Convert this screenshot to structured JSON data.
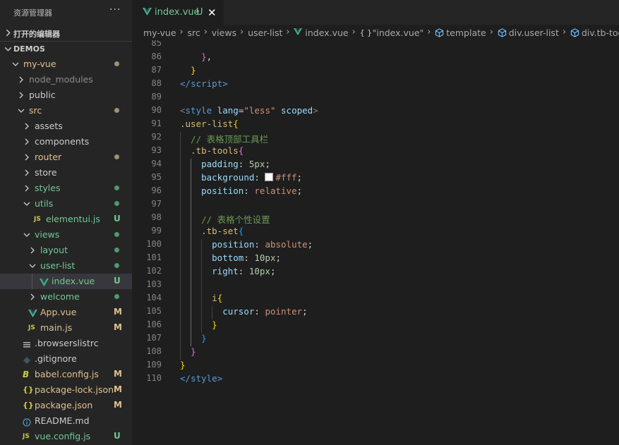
{
  "explorer": {
    "title": "资源管理器",
    "more": "···",
    "open_editors": "打开的编辑器",
    "root": "DEMOS"
  },
  "tree": [
    {
      "name": "my-vue",
      "indent": 0,
      "kind": "folder",
      "open": true,
      "color": "#e2c08d",
      "status": "dot",
      "status_color": "#a08f72"
    },
    {
      "name": "node_modules",
      "indent": 1,
      "kind": "folder",
      "open": false,
      "color": "#8c8c8c"
    },
    {
      "name": "public",
      "indent": 1,
      "kind": "folder",
      "open": false,
      "color": "#cccccc"
    },
    {
      "name": "src",
      "indent": 1,
      "kind": "folder",
      "open": true,
      "color": "#e2c08d",
      "status": "dot",
      "status_color": "#a08f72"
    },
    {
      "name": "assets",
      "indent": 2,
      "kind": "folder",
      "open": false,
      "color": "#cccccc"
    },
    {
      "name": "components",
      "indent": 2,
      "kind": "folder",
      "open": false,
      "color": "#cccccc"
    },
    {
      "name": "router",
      "indent": 2,
      "kind": "folder",
      "open": false,
      "color": "#e2c08d",
      "status": "dot",
      "status_color": "#a08f72"
    },
    {
      "name": "store",
      "indent": 2,
      "kind": "folder",
      "open": false,
      "color": "#cccccc"
    },
    {
      "name": "styles",
      "indent": 2,
      "kind": "folder",
      "open": false,
      "color": "#73c991",
      "status": "dot",
      "status_color": "#4e9a6a"
    },
    {
      "name": "utils",
      "indent": 2,
      "kind": "folder",
      "open": true,
      "color": "#73c991",
      "status": "dot",
      "status_color": "#4e9a6a"
    },
    {
      "name": "elementui.js",
      "indent": 3,
      "kind": "js",
      "color": "#73c991",
      "status": "U",
      "status_color": "#73c991"
    },
    {
      "name": "views",
      "indent": 2,
      "kind": "folder",
      "open": true,
      "color": "#73c991",
      "status": "dot",
      "status_color": "#4e9a6a"
    },
    {
      "name": "layout",
      "indent": 3,
      "kind": "folder",
      "open": false,
      "color": "#73c991",
      "status": "dot",
      "status_color": "#4e9a6a"
    },
    {
      "name": "user-list",
      "indent": 3,
      "kind": "folder",
      "open": true,
      "color": "#73c991",
      "status": "dot",
      "status_color": "#4e9a6a"
    },
    {
      "name": "index.vue",
      "indent": 4,
      "kind": "vue",
      "color": "#73c991",
      "status": "U",
      "status_color": "#73c991",
      "selected": true
    },
    {
      "name": "welcome",
      "indent": 3,
      "kind": "folder",
      "open": false,
      "color": "#73c991",
      "status": "dot",
      "status_color": "#4e9a6a"
    },
    {
      "name": "App.vue",
      "indent": 2,
      "kind": "vue",
      "color": "#e2c08d",
      "status": "M",
      "status_color": "#e2c08d"
    },
    {
      "name": "main.js",
      "indent": 2,
      "kind": "js",
      "color": "#e2c08d",
      "status": "M",
      "status_color": "#e2c08d"
    },
    {
      "name": ".browserslistrc",
      "indent": 1,
      "kind": "lines",
      "color": "#cccccc"
    },
    {
      "name": ".gitignore",
      "indent": 1,
      "kind": "git",
      "color": "#cccccc"
    },
    {
      "name": "babel.config.js",
      "indent": 1,
      "kind": "babel",
      "color": "#e2c08d",
      "status": "M",
      "status_color": "#e2c08d"
    },
    {
      "name": "package-lock.json",
      "indent": 1,
      "kind": "json",
      "color": "#e2c08d",
      "status": "M",
      "status_color": "#e2c08d"
    },
    {
      "name": "package.json",
      "indent": 1,
      "kind": "json",
      "color": "#e2c08d",
      "status": "M",
      "status_color": "#e2c08d"
    },
    {
      "name": "README.md",
      "indent": 1,
      "kind": "info",
      "color": "#cccccc"
    },
    {
      "name": "vue.config.js",
      "indent": 1,
      "kind": "js",
      "color": "#73c991",
      "status": "U",
      "status_color": "#73c991"
    }
  ],
  "tab": {
    "name": "index.vue",
    "status": "U",
    "close": "✕"
  },
  "breadcrumb": [
    {
      "text": "my-vue"
    },
    {
      "text": "src"
    },
    {
      "text": "views"
    },
    {
      "text": "user-list"
    },
    {
      "text": "index.vue",
      "icon": "vue"
    },
    {
      "text": "\"index.vue\"",
      "icon": "braces"
    },
    {
      "text": "template",
      "icon": "cube"
    },
    {
      "text": "div.user-list",
      "icon": "cube"
    },
    {
      "text": "div.tb-tools",
      "icon": "cube"
    }
  ],
  "code": [
    {
      "n": "85",
      "t": []
    },
    {
      "n": "86",
      "t": [
        [
          "    ",
          "plain"
        ],
        [
          "}",
          "b2"
        ],
        [
          ",",
          "plain"
        ]
      ]
    },
    {
      "n": "87",
      "t": [
        [
          "  ",
          "plain"
        ],
        [
          "}",
          "b1"
        ]
      ]
    },
    {
      "n": "88",
      "t": [
        [
          "</",
          "tag"
        ],
        [
          "script",
          "tag"
        ],
        [
          ">",
          "tag"
        ]
      ]
    },
    {
      "n": "89",
      "t": []
    },
    {
      "n": "90",
      "t": [
        [
          "<",
          "punc"
        ],
        [
          "style",
          "tag"
        ],
        [
          " ",
          "plain"
        ],
        [
          "lang",
          "attr"
        ],
        [
          "=",
          "plain"
        ],
        [
          "\"less\"",
          "str"
        ],
        [
          " ",
          "plain"
        ],
        [
          "scoped",
          "attr"
        ],
        [
          ">",
          "punc"
        ]
      ]
    },
    {
      "n": "91",
      "t": [
        [
          ".user-list",
          "sel"
        ],
        [
          "{",
          "b1"
        ]
      ]
    },
    {
      "n": "92",
      "t": [
        [
          "  ",
          "plain"
        ],
        [
          "// 表格顶部工具栏",
          "cmt"
        ]
      ]
    },
    {
      "n": "93",
      "t": [
        [
          "  ",
          "plain"
        ],
        [
          ".tb-tools",
          "sel"
        ],
        [
          "{",
          "b2"
        ]
      ]
    },
    {
      "n": "94",
      "t": [
        [
          "    ",
          "plain"
        ],
        [
          "padding",
          "prop"
        ],
        [
          ": ",
          "plain"
        ],
        [
          "5px",
          "num"
        ],
        [
          ";",
          "plain"
        ]
      ]
    },
    {
      "n": "95",
      "t": [
        [
          "    ",
          "plain"
        ],
        [
          "background",
          "prop"
        ],
        [
          ": ",
          "plain"
        ],
        [
          "",
          "swatch"
        ],
        [
          "#fff",
          "val"
        ],
        [
          ";",
          "plain"
        ]
      ]
    },
    {
      "n": "96",
      "t": [
        [
          "    ",
          "plain"
        ],
        [
          "position",
          "prop"
        ],
        [
          ": ",
          "plain"
        ],
        [
          "relative",
          "val"
        ],
        [
          ";",
          "plain"
        ]
      ]
    },
    {
      "n": "97",
      "t": []
    },
    {
      "n": "98",
      "t": [
        [
          "    ",
          "plain"
        ],
        [
          "// 表格个性设置",
          "cmt"
        ]
      ]
    },
    {
      "n": "99",
      "t": [
        [
          "    ",
          "plain"
        ],
        [
          ".tb-set",
          "sel"
        ],
        [
          "{",
          "b3"
        ]
      ]
    },
    {
      "n": "100",
      "t": [
        [
          "      ",
          "plain"
        ],
        [
          "position",
          "prop"
        ],
        [
          ": ",
          "plain"
        ],
        [
          "absolute",
          "val"
        ],
        [
          ";",
          "plain"
        ]
      ]
    },
    {
      "n": "101",
      "t": [
        [
          "      ",
          "plain"
        ],
        [
          "bottom",
          "prop"
        ],
        [
          ": ",
          "plain"
        ],
        [
          "10px",
          "num"
        ],
        [
          ";",
          "plain"
        ]
      ]
    },
    {
      "n": "102",
      "t": [
        [
          "      ",
          "plain"
        ],
        [
          "right",
          "prop"
        ],
        [
          ": ",
          "plain"
        ],
        [
          "10px",
          "num"
        ],
        [
          ";",
          "plain"
        ]
      ]
    },
    {
      "n": "103",
      "t": []
    },
    {
      "n": "104",
      "t": [
        [
          "      ",
          "plain"
        ],
        [
          "i",
          "sel"
        ],
        [
          "{",
          "b1"
        ]
      ]
    },
    {
      "n": "105",
      "t": [
        [
          "        ",
          "plain"
        ],
        [
          "cursor",
          "prop"
        ],
        [
          ": ",
          "plain"
        ],
        [
          "pointer",
          "val"
        ],
        [
          ";",
          "plain"
        ]
      ]
    },
    {
      "n": "106",
      "t": [
        [
          "      ",
          "plain"
        ],
        [
          "}",
          "b1"
        ]
      ]
    },
    {
      "n": "107",
      "t": [
        [
          "    ",
          "plain"
        ],
        [
          "}",
          "b3"
        ]
      ]
    },
    {
      "n": "108",
      "t": [
        [
          "  ",
          "plain"
        ],
        [
          "}",
          "b2"
        ]
      ]
    },
    {
      "n": "109",
      "t": [
        [
          "}",
          "b1"
        ]
      ]
    },
    {
      "n": "110",
      "t": [
        [
          "</",
          "tag"
        ],
        [
          "style",
          "tag"
        ],
        [
          ">",
          "tag"
        ]
      ]
    }
  ]
}
